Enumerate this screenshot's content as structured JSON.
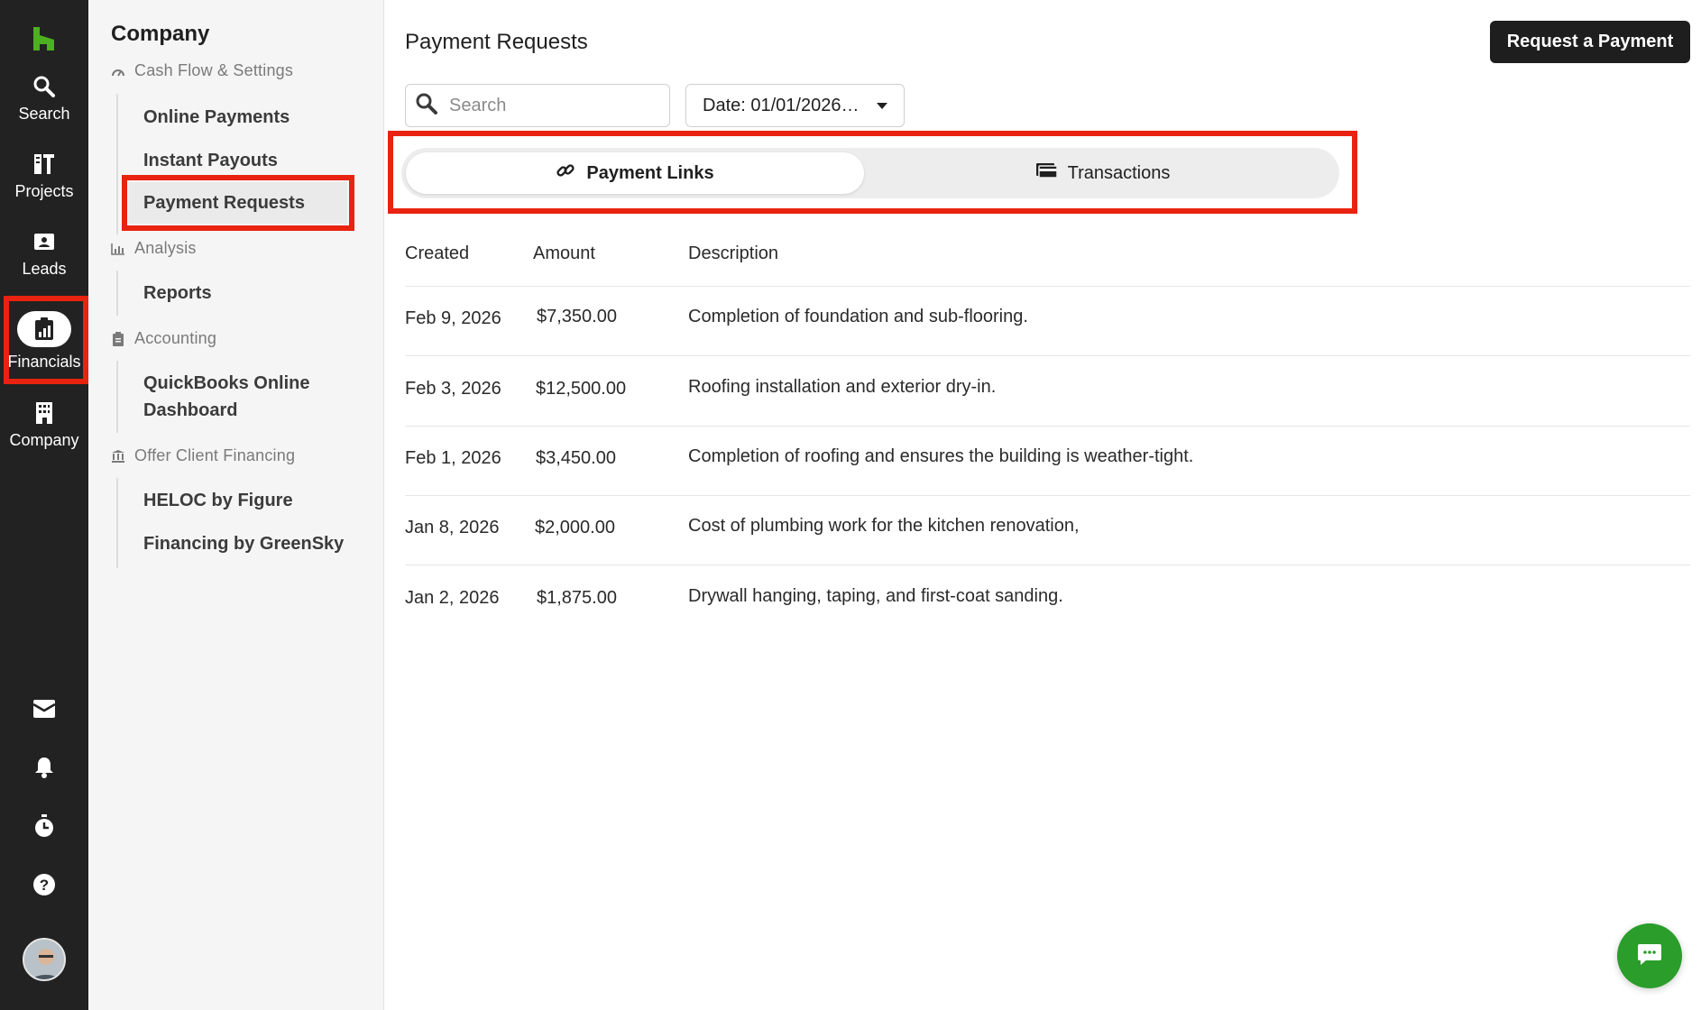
{
  "rail": {
    "items": [
      {
        "label": "Search",
        "icon": "search-icon"
      },
      {
        "label": "Projects",
        "icon": "projects-icon"
      },
      {
        "label": "Leads",
        "icon": "leads-icon"
      },
      {
        "label": "Financials",
        "icon": "financials-icon",
        "active": true
      },
      {
        "label": "Company",
        "icon": "building-icon"
      }
    ],
    "bottom_icons": [
      "inbox-icon",
      "bell-icon",
      "timer-icon",
      "help-icon"
    ]
  },
  "subnav": {
    "title": "Company",
    "groups": [
      {
        "heading": "Cash Flow & Settings",
        "icon": "gauge-icon",
        "links": [
          "Online Payments",
          "Instant Payouts",
          "Payment Requests"
        ]
      },
      {
        "heading": "Analysis",
        "icon": "bar-chart-icon",
        "links": [
          "Reports"
        ]
      },
      {
        "heading": "Accounting",
        "icon": "clipboard-icon",
        "links": [
          "QuickBooks Online Dashboard"
        ]
      },
      {
        "heading": "Offer Client Financing",
        "icon": "bank-icon",
        "links": [
          "HELOC by Figure",
          "Financing by GreenSky"
        ]
      }
    ],
    "active_link": "Payment Requests"
  },
  "main": {
    "title": "Payment Requests",
    "request_button": "Request a Payment",
    "search_placeholder": "Search",
    "date_filter": "Date: 01/01/2026…",
    "tabs": [
      {
        "label": "Payment Links",
        "icon": "link-icon",
        "active": true
      },
      {
        "label": "Transactions",
        "icon": "wallet-icon",
        "active": false
      }
    ],
    "table": {
      "headers": [
        "Created",
        "Amount",
        "Description"
      ],
      "rows": [
        {
          "created": "Feb 9, 2026",
          "amount": "$7,350.00",
          "description": "Completion of foundation and sub-flooring."
        },
        {
          "created": "Feb 3, 2026",
          "amount": "$12,500.00",
          "description": "Roofing installation and exterior dry-in."
        },
        {
          "created": "Feb 1, 2026",
          "amount": "$3,450.00",
          "description": "Completion of roofing and ensures the building is weather-tight."
        },
        {
          "created": "Jan 8, 2026",
          "amount": "$2,000.00",
          "description": "Cost of plumbing work for the kitchen renovation,"
        },
        {
          "created": "Jan 2, 2026",
          "amount": "$1,875.00",
          "description": "Drywall hanging, taping, and first-coat sanding."
        }
      ]
    }
  },
  "colors": {
    "rail_bg": "#222222",
    "highlight": "#e8230f",
    "brand_green": "#4cb01f",
    "chat_green": "#2a9d2a"
  }
}
